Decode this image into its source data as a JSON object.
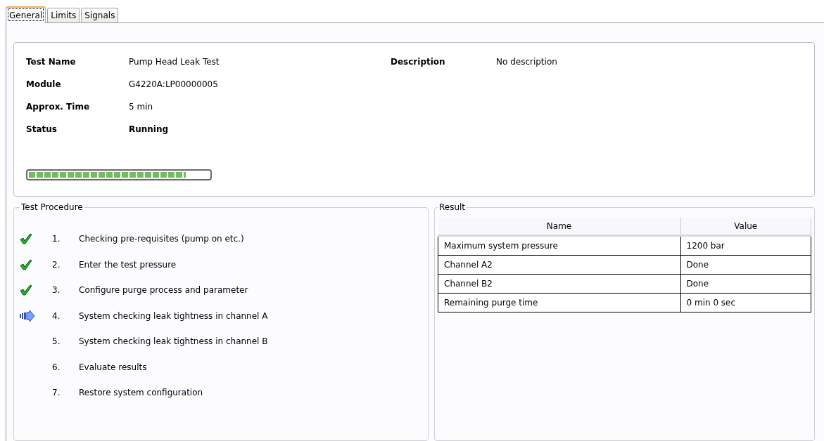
{
  "tabs": [
    {
      "label": "General",
      "selected": true
    },
    {
      "label": "Limits",
      "selected": false
    },
    {
      "label": "Signals",
      "selected": false
    }
  ],
  "info": {
    "fields": [
      {
        "label": "Test Name",
        "value": "Pump Head Leak Test",
        "bold": false
      },
      {
        "label": "Module",
        "value": "G4220A:LP00000005",
        "bold": false
      },
      {
        "label": "Approx. Time",
        "value": "5 min",
        "bold": false
      },
      {
        "label": "Status",
        "value": "Running",
        "bold": true
      }
    ],
    "description": {
      "label": "Description",
      "value": "No description"
    },
    "progress": {
      "level": 0.87
    }
  },
  "procedure": {
    "title": "Test Procedure",
    "steps": [
      {
        "number": "1.",
        "text": "Checking pre-requisites (pump on etc.)",
        "kind": "done"
      },
      {
        "number": "2.",
        "text": "Enter the test pressure",
        "kind": "done"
      },
      {
        "number": "3.",
        "text": "Configure purge process and parameter",
        "kind": "done"
      },
      {
        "number": "4.",
        "text": "System checking leak tightness in channel A",
        "kind": "current"
      },
      {
        "number": "5.",
        "text": "System checking leak tightness in channel B",
        "kind": "pending"
      },
      {
        "number": "6.",
        "text": "Evaluate results",
        "kind": "pending"
      },
      {
        "number": "7.",
        "text": "Restore system configuration",
        "kind": "pending"
      }
    ]
  },
  "result": {
    "title": "Result",
    "columns": [
      "Name",
      "Value"
    ],
    "rows": [
      [
        "Maximum system pressure",
        "1200 bar"
      ],
      [
        "Channel A2",
        "Done"
      ],
      [
        "Channel B2",
        "Done"
      ],
      [
        "Remaining purge time",
        "0 min 0 sec"
      ]
    ]
  }
}
